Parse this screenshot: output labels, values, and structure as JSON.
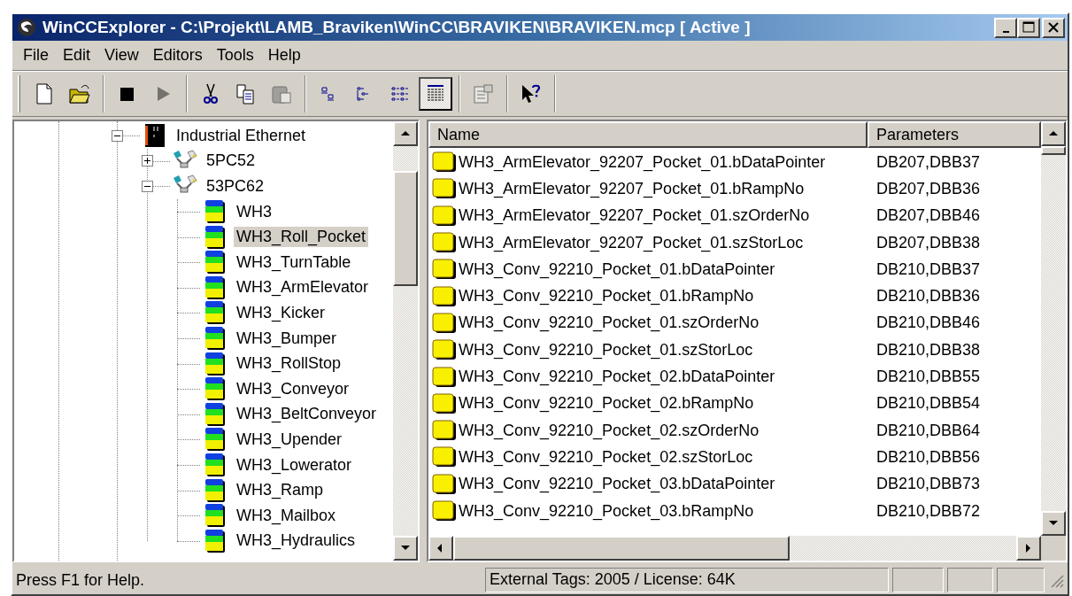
{
  "window": {
    "title": "WinCCExplorer - C:\\Projekt\\LAMB_Braviken\\WinCC\\BRAVIKEN\\BRAVIKEN.mcp [ Active ]"
  },
  "menu": [
    "File",
    "Edit",
    "View",
    "Editors",
    "Tools",
    "Help"
  ],
  "toolbar": [
    {
      "kind": "new",
      "disabled": false
    },
    {
      "kind": "open",
      "disabled": false
    },
    {
      "kind": "separator"
    },
    {
      "kind": "stop",
      "disabled": false
    },
    {
      "kind": "run",
      "disabled": true
    },
    {
      "kind": "separator"
    },
    {
      "kind": "cut",
      "disabled": false
    },
    {
      "kind": "copy",
      "disabled": false
    },
    {
      "kind": "paste",
      "disabled": true
    },
    {
      "kind": "separator"
    },
    {
      "kind": "large-icons",
      "selected": false
    },
    {
      "kind": "small-icons",
      "selected": false
    },
    {
      "kind": "list",
      "selected": false
    },
    {
      "kind": "details",
      "selected": true
    },
    {
      "kind": "separator"
    },
    {
      "kind": "properties",
      "disabled": true
    },
    {
      "kind": "separator"
    },
    {
      "kind": "help",
      "disabled": false
    }
  ],
  "tree": {
    "items": [
      {
        "label": "Industrial Ethernet",
        "kind": "network",
        "expanded": true,
        "selected": false,
        "children": [
          {
            "label": "5PC52",
            "kind": "station",
            "expanded": false,
            "selected": false
          },
          {
            "label": "53PC62",
            "kind": "station",
            "expanded": true,
            "selected": false,
            "children": [
              {
                "label": "WH3",
                "kind": "connection",
                "selected": false
              },
              {
                "label": "WH3_Roll_Pocket",
                "kind": "connection",
                "selected": true
              },
              {
                "label": "WH3_TurnTable",
                "kind": "connection",
                "selected": false
              },
              {
                "label": "WH3_ArmElevator",
                "kind": "connection",
                "selected": false
              },
              {
                "label": "WH3_Kicker",
                "kind": "connection",
                "selected": false
              },
              {
                "label": "WH3_Bumper",
                "kind": "connection",
                "selected": false
              },
              {
                "label": "WH3_RollStop",
                "kind": "connection",
                "selected": false
              },
              {
                "label": "WH3_Conveyor",
                "kind": "connection",
                "selected": false
              },
              {
                "label": "WH3_BeltConveyor",
                "kind": "connection",
                "selected": false
              },
              {
                "label": "WH3_Upender",
                "kind": "connection",
                "selected": false
              },
              {
                "label": "WH3_Lowerator",
                "kind": "connection",
                "selected": false
              },
              {
                "label": "WH3_Ramp",
                "kind": "connection",
                "selected": false
              },
              {
                "label": "WH3_Mailbox",
                "kind": "connection",
                "selected": false
              },
              {
                "label": "WH3_Hydraulics",
                "kind": "connection",
                "selected": false
              }
            ]
          }
        ]
      }
    ]
  },
  "table": {
    "columns": [
      "Name",
      "Parameters"
    ],
    "rows": [
      {
        "name": "WH3_ArmElevator_92207_Pocket_01.bDataPointer",
        "parameters": "DB207,DBB37"
      },
      {
        "name": "WH3_ArmElevator_92207_Pocket_01.bRampNo",
        "parameters": "DB207,DBB36"
      },
      {
        "name": "WH3_ArmElevator_92207_Pocket_01.szOrderNo",
        "parameters": "DB207,DBB46"
      },
      {
        "name": "WH3_ArmElevator_92207_Pocket_01.szStorLoc",
        "parameters": "DB207,DBB38"
      },
      {
        "name": "WH3_Conv_92210_Pocket_01.bDataPointer",
        "parameters": "DB210,DBB37"
      },
      {
        "name": "WH3_Conv_92210_Pocket_01.bRampNo",
        "parameters": "DB210,DBB36"
      },
      {
        "name": "WH3_Conv_92210_Pocket_01.szOrderNo",
        "parameters": "DB210,DBB46"
      },
      {
        "name": "WH3_Conv_92210_Pocket_01.szStorLoc",
        "parameters": "DB210,DBB38"
      },
      {
        "name": "WH3_Conv_92210_Pocket_02.bDataPointer",
        "parameters": "DB210,DBB55"
      },
      {
        "name": "WH3_Conv_92210_Pocket_02.bRampNo",
        "parameters": "DB210,DBB54"
      },
      {
        "name": "WH3_Conv_92210_Pocket_02.szOrderNo",
        "parameters": "DB210,DBB64"
      },
      {
        "name": "WH3_Conv_92210_Pocket_02.szStorLoc",
        "parameters": "DB210,DBB56"
      },
      {
        "name": "WH3_Conv_92210_Pocket_03.bDataPointer",
        "parameters": "DB210,DBB73"
      },
      {
        "name": "WH3_Conv_92210_Pocket_03.bRampNo",
        "parameters": "DB210,DBB72"
      }
    ]
  },
  "status_bar": {
    "help": "Press F1 for Help.",
    "tags": "External Tags: 2005 / License: 64K"
  }
}
